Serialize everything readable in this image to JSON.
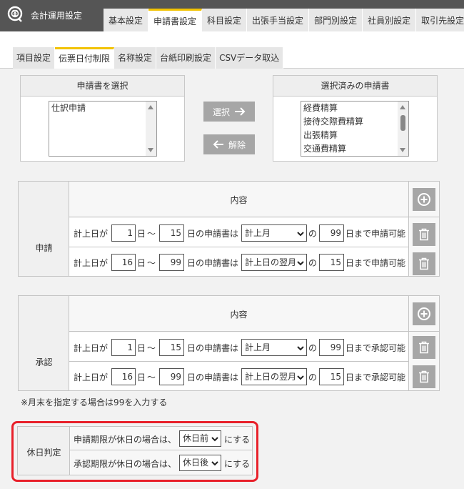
{
  "app": {
    "title": "会計運用設定"
  },
  "main_tabs": [
    {
      "label": "基本設定"
    },
    {
      "label": "申請書設定",
      "active": true
    },
    {
      "label": "科目設定"
    },
    {
      "label": "出張手当設定"
    },
    {
      "label": "部門別設定"
    },
    {
      "label": "社員別設定"
    },
    {
      "label": "取引先設定"
    }
  ],
  "sub_tabs": [
    {
      "label": "項目設定"
    },
    {
      "label": "伝票日付制限",
      "active": true
    },
    {
      "label": "名称設定"
    },
    {
      "label": "台紙印刷設定"
    },
    {
      "label": "CSVデータ取込"
    }
  ],
  "select_panel": {
    "title": "申請書を選択",
    "options": [
      "仕訳申請"
    ]
  },
  "selected_panel": {
    "title": "選択済みの申請書",
    "options": [
      "経費精算",
      "接待交際費精算",
      "出張精算",
      "交通費精算"
    ]
  },
  "buttons": {
    "select": "選択",
    "remove": "解除"
  },
  "icons": {
    "select": "arrow-right-icon",
    "remove": "arrow-left-icon",
    "add": "plus-circle-icon",
    "delete": "trash-icon",
    "logo": "yen-gear-icon"
  },
  "colors": {
    "header": "#555555",
    "tab_accent": "#f2c200",
    "highlight": "#e8202a",
    "button": "#a6a6a6"
  },
  "common": {
    "content_header": "内容",
    "prefix": "計上日が",
    "day": "日",
    "tilde": "～",
    "of_apps": "日の申請書は",
    "particle": "の"
  },
  "apply_table": {
    "label": "申請",
    "rows": [
      {
        "from": "1",
        "to": "15",
        "month": "計上月",
        "until": "99",
        "suffix": "日まで申請可能"
      },
      {
        "from": "16",
        "to": "99",
        "month": "計上日の翌月",
        "until": "15",
        "suffix": "日まで申請可能"
      }
    ]
  },
  "approve_table": {
    "label": "承認",
    "rows": [
      {
        "from": "1",
        "to": "15",
        "month": "計上月",
        "until": "99",
        "suffix": "日まで承認可能"
      },
      {
        "from": "16",
        "to": "99",
        "month": "計上日の翌月",
        "until": "15",
        "suffix": "日まで承認可能"
      }
    ]
  },
  "note": "※月末を指定する場合は99を入力する",
  "holiday": {
    "label": "休日判定",
    "rows": [
      {
        "text": "申請期限が休日の場合は、",
        "value": "休日前",
        "suffix": "にする"
      },
      {
        "text": "承認期限が休日の場合は、",
        "value": "休日後",
        "suffix": "にする"
      }
    ]
  }
}
